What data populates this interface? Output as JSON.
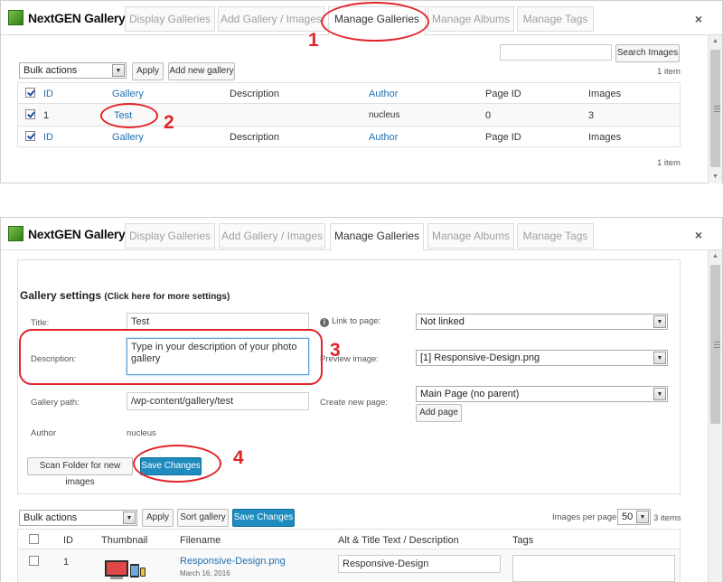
{
  "brand": {
    "name": "NextGEN Gallery"
  },
  "tabs": [
    {
      "label": "Display Galleries"
    },
    {
      "label": "Add Gallery / Images"
    },
    {
      "label": "Manage Galleries"
    },
    {
      "label": "Manage Albums"
    },
    {
      "label": "Manage Tags"
    }
  ],
  "close_label": "×",
  "step1": {
    "search_button": "Search Images",
    "search_placeholder": "",
    "bulk_actions": "Bulk actions",
    "apply_label": "Apply",
    "add_new_gallery_label": "Add new gallery",
    "item_count": "1 item",
    "columns": {
      "id": "ID",
      "gallery": "Gallery",
      "description": "Description",
      "author": "Author",
      "page_id": "Page ID",
      "images": "Images"
    },
    "rows": [
      {
        "id": "1",
        "gallery": "Test",
        "description": "",
        "author": "nucleus",
        "page_id": "0",
        "images": "3"
      }
    ],
    "footer_count": "1 item"
  },
  "step2": {
    "section_title": "Gallery settings",
    "section_title_hint": "(Click here for more settings)",
    "title_label": "Title:",
    "title_value": "Test",
    "description_label": "Description:",
    "description_value": "Type in your description of your photo gallery",
    "gallery_path_label": "Gallery path:",
    "gallery_path_value": "/wp-content/gallery/test",
    "author_label": "Author",
    "author_value": "nucleus",
    "link_to_page_label": "Link to page:",
    "link_to_page_value": "Not linked",
    "preview_image_label": "Preview image:",
    "preview_image_value": "[1] Responsive-Design.png",
    "create_new_page_label": "Create new page:",
    "create_new_page_value": "Main Page (no parent)",
    "add_page_label": "Add page",
    "scan_folder_label": "Scan Folder for new images",
    "save_changes_label": "Save Changes",
    "bulk_actions": "Bulk actions",
    "apply_label": "Apply",
    "sort_gallery_label": "Sort gallery",
    "save_changes_label_2": "Save Changes",
    "images_per_page_label": "Images per page:",
    "images_per_page_value": "50",
    "images_count": "3 items",
    "columns": {
      "id": "ID",
      "thumbnail": "Thumbnail",
      "filename": "Filename",
      "alt_title": "Alt & Title Text / Description",
      "tags": "Tags"
    },
    "rows": [
      {
        "id": "1",
        "filename": "Responsive-Design.png",
        "date": "March 16, 2016",
        "alt_title": "Responsive-Design"
      }
    ]
  },
  "annotations": [
    "1",
    "2",
    "3",
    "4"
  ],
  "colors": {
    "accent": "#1e8cbe",
    "link": "#2271b1",
    "annotation": "#e3242b",
    "logo_green": "#3f9a24"
  }
}
